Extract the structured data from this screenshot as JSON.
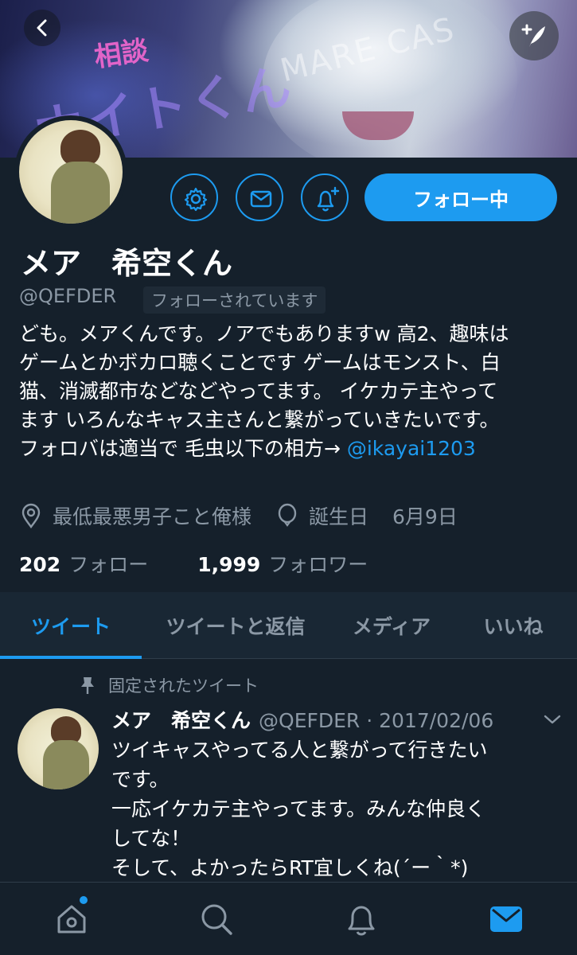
{
  "banner": {
    "overlay_text": "MARE CAS",
    "kanji_text": "相談",
    "big_text": "ナイトくん"
  },
  "header": {
    "back_icon": "chevron-left-icon",
    "compose_icon": "compose-quill-icon"
  },
  "actions": {
    "settings_icon": "gear-icon",
    "message_icon": "envelope-icon",
    "notify_icon": "bell-plus-icon",
    "follow_label": "フォロー中"
  },
  "profile": {
    "display_name": "メア　希空くん",
    "handle": "@QEFDER",
    "follows_you": "フォローされています",
    "bio_lines": [
      "ども。メアくんです。ノアでもありますw 高2、趣味は",
      "ゲームとかボカロ聴くことです ゲームはモンスト、白",
      "猫、消滅都市などなどやってます。 イケカテ主やって",
      "ます いろんなキャス主さんと繋がっていきたいです。"
    ],
    "bio_last_line": "フォロバは適当で 毛虫以下の相方→ ",
    "bio_link": "@ikayai1203",
    "location": "最低最悪男子こと俺様",
    "birthday_label": "誕生日",
    "birthday": "6月9日",
    "following_count": "202",
    "following_label": "フォロー",
    "followers_count": "1,999",
    "followers_label": "フォロワー"
  },
  "tabs": [
    {
      "label": "ツイート",
      "active": true
    },
    {
      "label": "ツイートと返信",
      "active": false
    },
    {
      "label": "メディア",
      "active": false
    },
    {
      "label": "いいね",
      "active": false
    }
  ],
  "pinned_tweet": {
    "pinned_label": "固定されたツイート",
    "name": "メア　希空くん",
    "meta": "@QEFDER · 2017/02/06",
    "lines": [
      "ツイキャスやってる人と繋がって行きたい",
      "です。",
      "一応イケカテ主やってます。みんな仲良く",
      "してな！",
      "そして、よかったらRT宜しくね(´ー｀*)"
    ]
  },
  "bottom_nav": {
    "items": [
      "home-icon",
      "search-icon",
      "bell-icon",
      "mail-icon"
    ],
    "active": "mail-icon"
  },
  "colors": {
    "background": "#15202b",
    "accent": "#1d9bf0",
    "secondary_text": "#8b98a5"
  }
}
